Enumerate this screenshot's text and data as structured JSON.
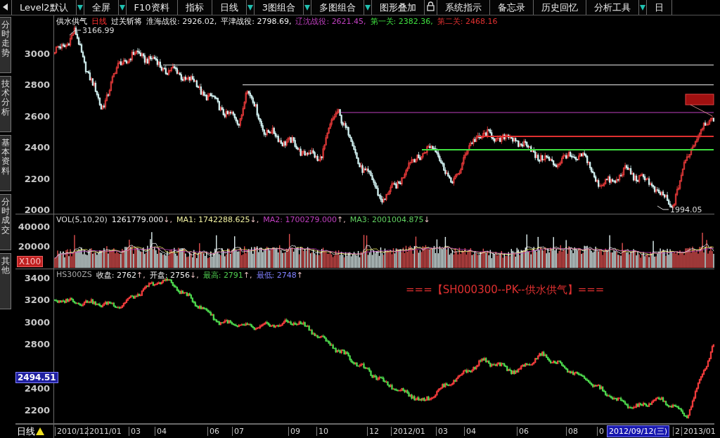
{
  "toolbar": {
    "items": [
      {
        "kind": "button",
        "label": "Level2默认",
        "dropdown": true
      },
      {
        "kind": "button",
        "label": "全屏",
        "dropdown": true
      },
      {
        "kind": "button",
        "label": "F10资料",
        "dropdown": false
      },
      {
        "kind": "button",
        "label": "指标",
        "dropdown": false
      },
      {
        "kind": "button",
        "label": "日线",
        "dropdown": true
      },
      {
        "kind": "button",
        "label": "3图组合",
        "dropdown": true
      },
      {
        "kind": "button",
        "label": "多图组合",
        "dropdown": true
      },
      {
        "kind": "button",
        "label": "图形叠加",
        "dropdown": false
      },
      {
        "kind": "lock"
      },
      {
        "kind": "button",
        "label": "系统指示",
        "dropdown": false
      },
      {
        "kind": "button",
        "label": "备忘录",
        "dropdown": false
      },
      {
        "kind": "button",
        "label": "历史回忆",
        "dropdown": false
      },
      {
        "kind": "button",
        "label": "分析工具",
        "dropdown": true
      },
      {
        "kind": "button",
        "label": "日",
        "dropdown": false
      }
    ]
  },
  "sidebar": {
    "tabs": [
      "分时走势",
      "技术分析",
      "基本资料",
      "分时成交",
      "其他"
    ]
  },
  "main_chart": {
    "title": "供水供气",
    "period": "日线",
    "indicator": "过关斩将",
    "levels": [
      {
        "name": "淮海战役:",
        "value": "2926.02,",
        "color": "#e8e8e8"
      },
      {
        "name": "平津战役:",
        "value": "2798.69,",
        "color": "#f4f4f4"
      },
      {
        "name": "辽沈战役:",
        "value": "2621.45,",
        "color": "#c040c0"
      },
      {
        "name": "第一关:",
        "value": "2382.36,",
        "color": "#40e040"
      },
      {
        "name": "第二关:",
        "value": "2468.16",
        "color": "#e03030"
      }
    ],
    "high_label": "3166.99",
    "low_label": "1994.05",
    "yticks": [
      "3000",
      "2800",
      "2600",
      "2400",
      "2200",
      "2000"
    ]
  },
  "volume": {
    "label": "VOL(5,10,20)",
    "items": [
      {
        "value": "1261779.000",
        "arrow": "↓,",
        "color": "#f0f0f0"
      },
      {
        "name": "MA1:",
        "value": "1742288.625",
        "arrow": "↓,",
        "color": "#f0f0a0"
      },
      {
        "name": "MA2:",
        "value": "1700279.000",
        "arrow": "↑,",
        "color": "#c040c0"
      },
      {
        "name": "MA3:",
        "value": "2001004.875",
        "arrow": "↓",
        "color": "#60d060"
      }
    ],
    "yticks": [
      "40000",
      "20000"
    ],
    "unit": "X100"
  },
  "index_chart": {
    "code": "HS300ZS",
    "fields": [
      {
        "name": "收盘:",
        "value": "2762",
        "arrow": "↑,",
        "color": "#f0f0f0"
      },
      {
        "name": "开盘:",
        "value": "2756",
        "arrow": "↓,",
        "color": "#f0f0f0"
      },
      {
        "name": "最高:",
        "value": "2791",
        "arrow": "↑,",
        "color": "#50d050"
      },
      {
        "name": "最低:",
        "value": "2748",
        "arrow": "↑",
        "color": "#8080ff"
      }
    ],
    "overlay_title": "===【SH000300--PK--供水供气】===",
    "yticks": [
      "3400",
      "3200",
      "3000",
      "2800",
      "2400",
      "2200"
    ],
    "cursor_value": "2494.51"
  },
  "date_axis": {
    "period": "日线",
    "labels": [
      "2010/12",
      "2011/01",
      "03",
      "04",
      "06",
      "07",
      "09",
      "10",
      "12",
      "2012/01",
      "03",
      "04",
      "06",
      "08",
      "0",
      "2",
      "2013/01"
    ],
    "cursor_date": "2012/09/12(三)"
  }
}
